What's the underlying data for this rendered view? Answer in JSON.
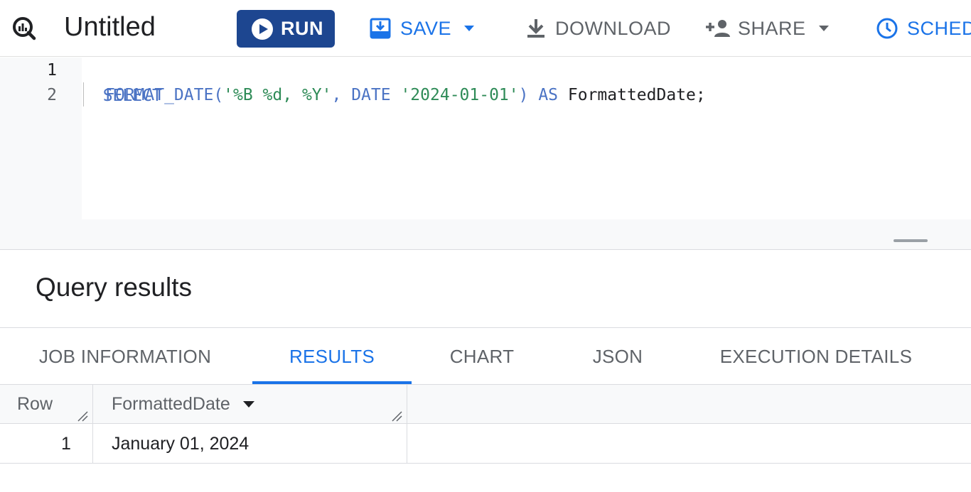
{
  "toolbar": {
    "title": "Untitled",
    "run_label": "RUN",
    "save_label": "SAVE",
    "download_label": "DOWNLOAD",
    "share_label": "SHARE",
    "schedule_label": "SCHED"
  },
  "editor": {
    "lines": [
      {
        "number": "1",
        "tokens": [
          "SELECT"
        ]
      },
      {
        "number": "2",
        "tokens": [
          "FORMAT_DATE(",
          "'%B %d, %Y'",
          ", ",
          "DATE ",
          "'2024-01-01'",
          ") ",
          "AS ",
          "FormattedDate;"
        ]
      }
    ]
  },
  "results": {
    "title": "Query results",
    "tabs": [
      {
        "label": "JOB INFORMATION",
        "active": false
      },
      {
        "label": "RESULTS",
        "active": true
      },
      {
        "label": "CHART",
        "active": false
      },
      {
        "label": "JSON",
        "active": false
      },
      {
        "label": "EXECUTION DETAILS",
        "active": false
      }
    ],
    "table": {
      "columns": [
        "Row",
        "FormattedDate"
      ],
      "rows": [
        {
          "row": "1",
          "value": "January 01, 2024"
        }
      ]
    }
  },
  "icons": {
    "logo": "bigquery-icon",
    "run": "play-circle-icon",
    "save": "save-icon",
    "download": "download-icon",
    "share": "person-add-icon",
    "schedule": "clock-icon"
  },
  "colors": {
    "primary_button": "#1d4690",
    "accent": "#1a73e8",
    "keyword": "#4b73c4",
    "string": "#2e8b57"
  }
}
